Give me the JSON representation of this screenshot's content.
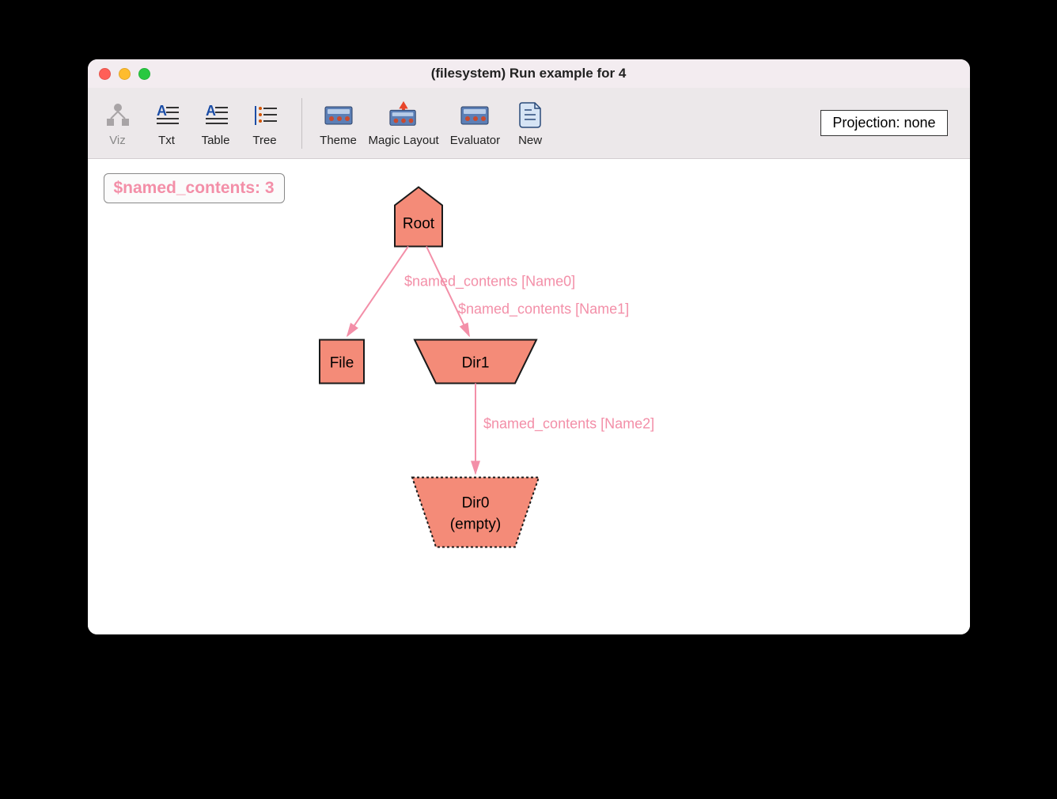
{
  "window": {
    "title": "(filesystem) Run example for 4"
  },
  "toolbar": {
    "viz": "Viz",
    "txt": "Txt",
    "table": "Table",
    "tree": "Tree",
    "theme": "Theme",
    "magic_layout": "Magic Layout",
    "evaluator": "Evaluator",
    "new": "New"
  },
  "projection": {
    "label": "Projection: none"
  },
  "legend": {
    "text": "$named_contents: 3"
  },
  "nodes": {
    "root": "Root",
    "file": "File",
    "dir1": "Dir1",
    "dir0_line1": "Dir0",
    "dir0_line2": "(empty)"
  },
  "edges": {
    "root_file": "$named_contents [Name0]",
    "root_dir1": "$named_contents [Name1]",
    "dir1_dir0": "$named_contents [Name2]"
  }
}
